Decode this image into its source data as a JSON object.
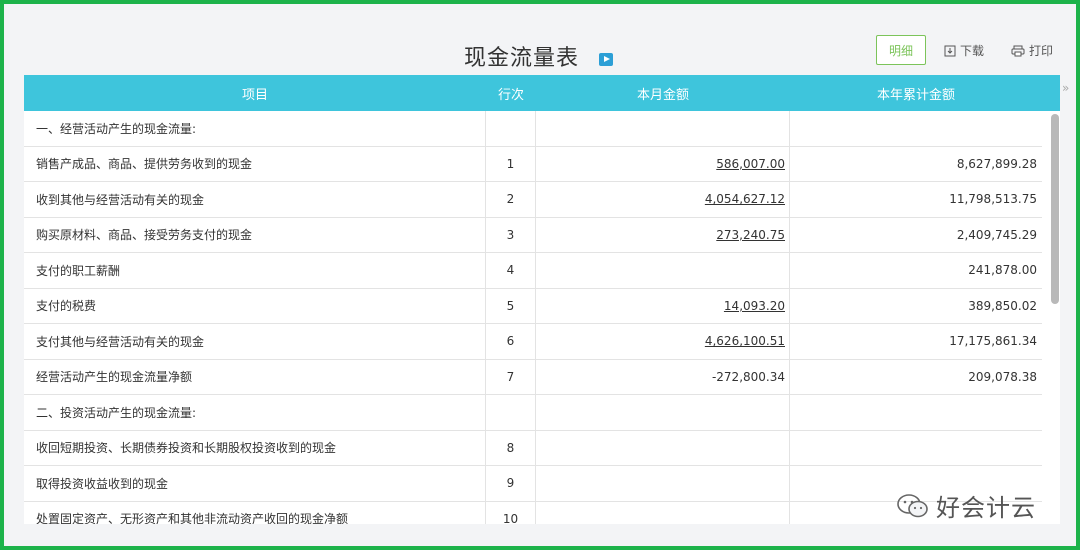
{
  "header": {
    "title": "现金流量表",
    "detail_button": "明细",
    "download_label": "下载",
    "print_label": "打印"
  },
  "table": {
    "columns": [
      "项目",
      "行次",
      "本月金额",
      "本年累计金额"
    ],
    "rows": [
      {
        "item": "一、经营活动产生的现金流量:",
        "line": "",
        "month": "",
        "year": "",
        "month_link": false
      },
      {
        "item": "销售产成品、商品、提供劳务收到的现金",
        "line": "1",
        "month": "586,007.00",
        "year": "8,627,899.28",
        "month_link": true
      },
      {
        "item": "收到其他与经营活动有关的现金",
        "line": "2",
        "month": "4,054,627.12",
        "year": "11,798,513.75",
        "month_link": true
      },
      {
        "item": "购买原材料、商品、接受劳务支付的现金",
        "line": "3",
        "month": "273,240.75",
        "year": "2,409,745.29",
        "month_link": true
      },
      {
        "item": "支付的职工薪酬",
        "line": "4",
        "month": "",
        "year": "241,878.00",
        "month_link": false
      },
      {
        "item": "支付的税费",
        "line": "5",
        "month": "14,093.20",
        "year": "389,850.02",
        "month_link": true
      },
      {
        "item": "支付其他与经营活动有关的现金",
        "line": "6",
        "month": "4,626,100.51",
        "year": "17,175,861.34",
        "month_link": true
      },
      {
        "item": "经营活动产生的现金流量净额",
        "line": "7",
        "month": "-272,800.34",
        "year": "209,078.38",
        "month_link": false
      },
      {
        "item": "二、投资活动产生的现金流量:",
        "line": "",
        "month": "",
        "year": "",
        "month_link": false
      },
      {
        "item": "收回短期投资、长期债券投资和长期股权投资收到的现金",
        "line": "8",
        "month": "",
        "year": "",
        "month_link": false
      },
      {
        "item": "取得投资收益收到的现金",
        "line": "9",
        "month": "",
        "year": "",
        "month_link": false
      },
      {
        "item": "处置固定资产、无形资产和其他非流动资产收回的现金净额",
        "line": "10",
        "month": "",
        "year": "",
        "month_link": false
      }
    ]
  },
  "watermark": "好会计云",
  "icons": {
    "title_video": "video-play-icon",
    "download": "download-icon",
    "print": "printer-icon",
    "collapse": "double-chevron-right-icon",
    "watermark": "wechat-icon"
  },
  "colors": {
    "frame_border": "#1db34a",
    "table_header": "#3ec5dc",
    "detail_button": "#7cc45a",
    "video_icon": "#2c9fd6"
  }
}
